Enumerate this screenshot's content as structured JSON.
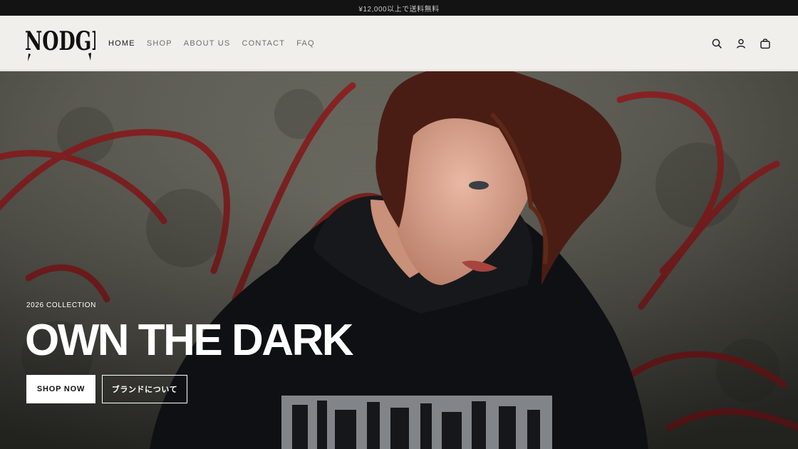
{
  "announcement": "¥12,000以上で送料無料",
  "header": {
    "logo_text": "NODGRID",
    "nav": [
      {
        "label": "HOME",
        "active": true
      },
      {
        "label": "SHOP",
        "active": false
      },
      {
        "label": "ABOUT US",
        "active": false
      },
      {
        "label": "CONTACT",
        "active": false
      },
      {
        "label": "FAQ",
        "active": false
      }
    ],
    "icons": [
      "search-icon",
      "account-icon",
      "cart-icon"
    ]
  },
  "hero": {
    "eyebrow": "2026 COLLECTION",
    "headline": "OWN THE DARK",
    "primary_button": "SHOP NOW",
    "secondary_button": "ブランドについて"
  },
  "colors": {
    "announcement_bg": "#131313",
    "header_bg": "#f1efeb",
    "graffiti_red": "#8f1d1f",
    "hoodie": "#0f1013"
  }
}
